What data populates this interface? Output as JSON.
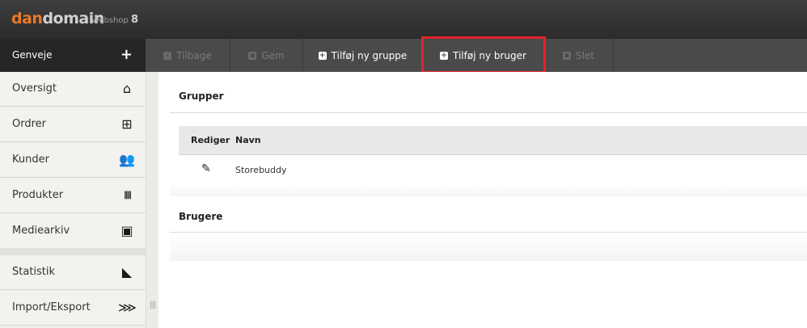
{
  "header": {
    "logo_part1": "dan",
    "logo_part2": "domain",
    "product": "Webshop",
    "version": "8"
  },
  "toolbar": {
    "shortcuts_label": "Genveje",
    "shortcuts_add": "+",
    "buttons": [
      {
        "label": "Tilbage",
        "icon": "back-icon",
        "glyph": "‹",
        "enabled": false
      },
      {
        "label": "Gem",
        "icon": "save-icon",
        "glyph": "▪",
        "enabled": false
      },
      {
        "label": "Tilføj ny gruppe",
        "icon": "plus-icon",
        "glyph": "+",
        "enabled": true
      },
      {
        "label": "Tilføj ny bruger",
        "icon": "plus-icon",
        "glyph": "+",
        "enabled": true
      },
      {
        "label": "Slet",
        "icon": "trash-icon",
        "glyph": "▪",
        "enabled": false
      }
    ],
    "highlight_color": "#e3232b"
  },
  "sidebar": {
    "items": [
      {
        "label": "Oversigt",
        "icon": "home-icon",
        "glyph": "⌂"
      },
      {
        "label": "Ordrer",
        "icon": "basket-icon",
        "glyph": "⊞"
      },
      {
        "label": "Kunder",
        "icon": "users-icon",
        "glyph": "👥"
      },
      {
        "label": "Produkter",
        "icon": "barcode-icon",
        "glyph": "|||||"
      },
      {
        "label": "Mediearkiv",
        "icon": "media-icon",
        "glyph": "▣"
      },
      {
        "label": "Statistik",
        "icon": "chart-icon",
        "glyph": "◣"
      },
      {
        "label": "Import/Eksport",
        "icon": "import-export-icon",
        "glyph": "⋙"
      }
    ]
  },
  "main": {
    "groups_title": "Grupper",
    "table": {
      "columns": [
        "Rediger",
        "Navn"
      ],
      "rows": [
        {
          "name": "Storebuddy",
          "icon": "edit-icon",
          "glyph": "✎"
        }
      ]
    },
    "users_title": "Brugere"
  },
  "colors": {
    "brand_orange": "#e8792a",
    "topbar": "#333333",
    "toolbar": "#4a4a4a"
  }
}
